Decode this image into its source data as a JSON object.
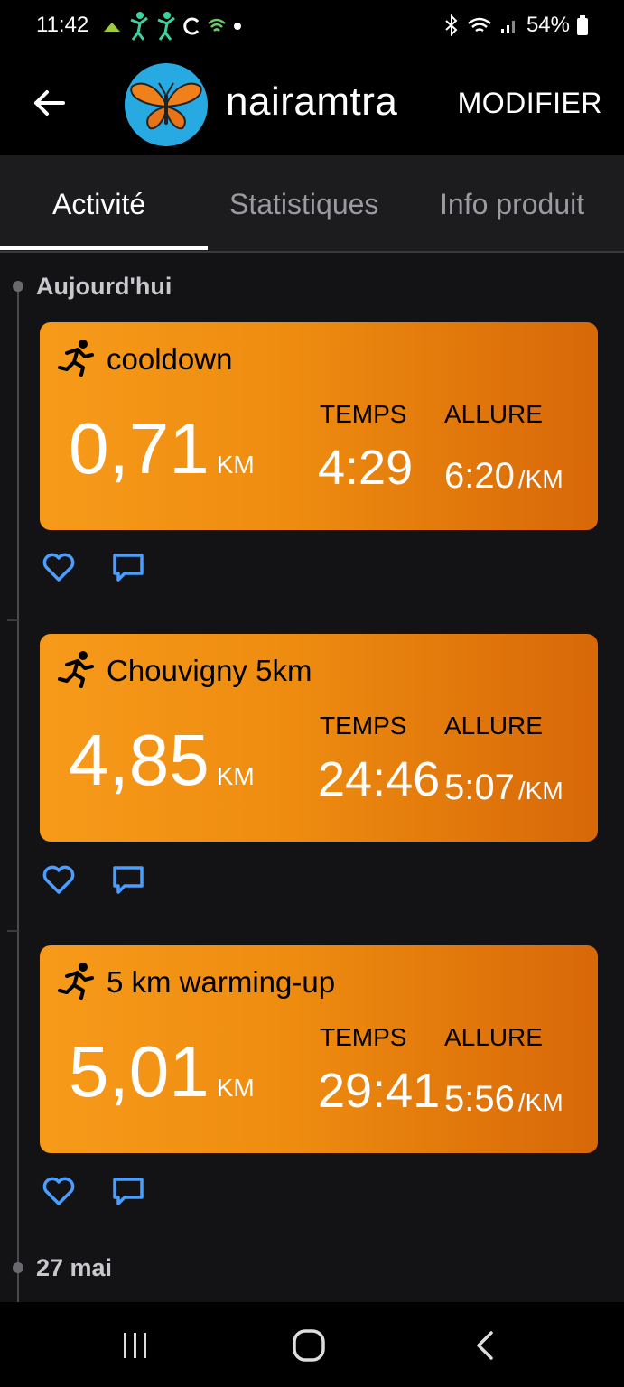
{
  "status_bar": {
    "time": "11:42",
    "battery": "54%"
  },
  "header": {
    "username": "nairamtra",
    "edit_label": "MODIFIER"
  },
  "tabs": [
    {
      "label": "Activité",
      "active": true
    },
    {
      "label": "Statistiques",
      "active": false
    },
    {
      "label": "Info produit",
      "active": false
    }
  ],
  "timeline": {
    "sections": [
      {
        "date": "Aujourd'hui",
        "activities": [
          {
            "name": "cooldown",
            "distance": "0,71",
            "distance_unit": "KM",
            "time_label": "TEMPS",
            "time": "4:29",
            "pace_label": "ALLURE",
            "pace": "6:20",
            "pace_unit": "/KM"
          },
          {
            "name": "Chouvigny 5km",
            "distance": "4,85",
            "distance_unit": "KM",
            "time_label": "TEMPS",
            "time": "24:46",
            "pace_label": "ALLURE",
            "pace": "5:07",
            "pace_unit": "/KM"
          },
          {
            "name": "5 km warming-up",
            "distance": "5,01",
            "distance_unit": "KM",
            "time_label": "TEMPS",
            "time": "29:41",
            "pace_label": "ALLURE",
            "pace": "5:56",
            "pace_unit": "/KM"
          }
        ]
      },
      {
        "date": "27 mai",
        "activities": []
      }
    ]
  },
  "colors": {
    "card_orange": "#f79a1a",
    "card_orange_dark": "#d86808",
    "action_blue": "#4a9eff",
    "background": "#131316"
  },
  "icons": {
    "back": "arrow-left-icon",
    "run": "runner-icon",
    "like": "heart-icon",
    "comment": "comment-icon"
  }
}
